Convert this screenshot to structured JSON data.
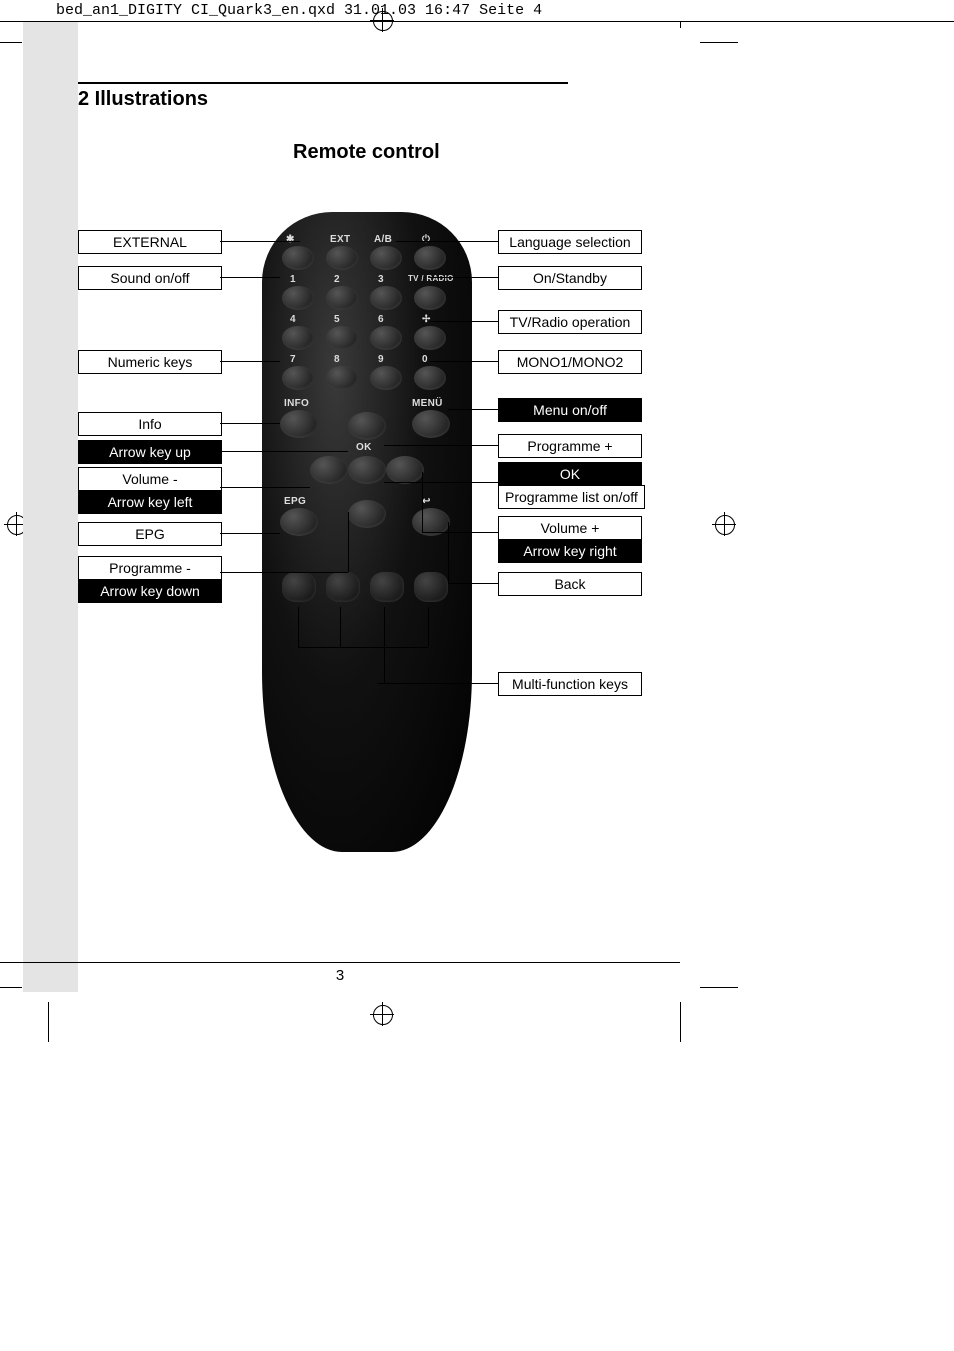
{
  "header": "bed_an1_DIGITY CI_Quark3_en.qxd  31.01.03  16:47  Seite 4",
  "section_heading": "2 Illustrations",
  "figure_title": "Remote control",
  "page_number": "3",
  "remote_buttons": {
    "row1_icons": [
      "✱",
      "EXT",
      "A/B",
      "⏻"
    ],
    "num": [
      "1",
      "2",
      "3",
      "4",
      "5",
      "6",
      "7",
      "8",
      "9",
      "0"
    ],
    "tvr": "TV / RADIO",
    "soundmode": "✢",
    "info": "INFO",
    "menu": "MENÜ",
    "ok": "OK",
    "epg": "EPG",
    "back": "↩"
  },
  "left_labels": [
    {
      "text": "EXTERNAL",
      "inv": false
    },
    {
      "text": "Sound on/off",
      "inv": false
    },
    {
      "text": "Numeric keys",
      "inv": false
    },
    {
      "text": "Info",
      "inv": false
    },
    {
      "text": "Arrow key up",
      "inv": true
    },
    {
      "text": "Volume -",
      "inv": false
    },
    {
      "text": "Arrow key left",
      "inv": true
    },
    {
      "text": "EPG",
      "inv": false
    },
    {
      "text": "Programme -",
      "inv": false
    },
    {
      "text": "Arrow key down",
      "inv": true
    }
  ],
  "right_labels": [
    {
      "text": "Language selection",
      "inv": false
    },
    {
      "text": "On/Standby",
      "inv": false
    },
    {
      "text": "TV/Radio operation",
      "inv": false
    },
    {
      "text": "MONO1/MONO2",
      "inv": false
    },
    {
      "text": "Menu on/off",
      "inv": true
    },
    {
      "text": "Programme +",
      "inv": false
    },
    {
      "text": "OK",
      "inv": true
    },
    {
      "text": "Programme list on/off",
      "inv": false
    },
    {
      "text": "Volume +",
      "inv": false
    },
    {
      "text": "Arrow key right",
      "inv": true
    },
    {
      "text": "Back",
      "inv": false
    },
    {
      "text": "Multi-function keys",
      "inv": false
    }
  ]
}
